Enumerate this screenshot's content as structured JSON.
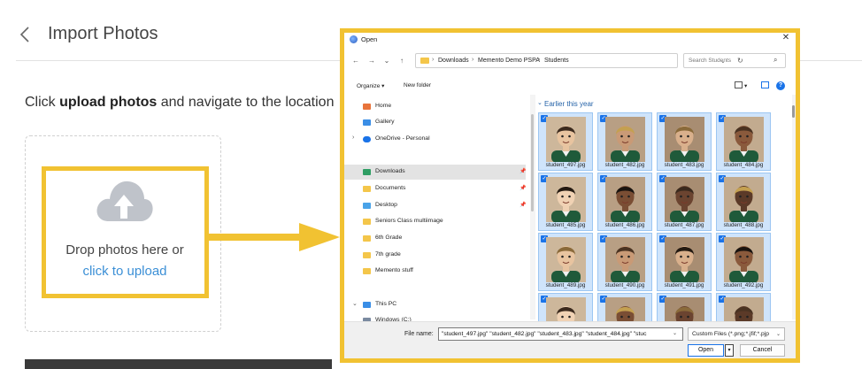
{
  "page": {
    "title": "Import Photos",
    "instructions": {
      "prefix": "Click ",
      "bold": "upload photos",
      "suffix": " and navigate to the location"
    },
    "dropzone": {
      "text": "Drop photos here or",
      "link": "click to upload"
    }
  },
  "dialog": {
    "title": "Open",
    "breadcrumb": [
      "Downloads",
      "Memento Demo PSPA",
      "Students"
    ],
    "search_placeholder": "Search Students",
    "commands": {
      "organize": "Organize ▾",
      "new_folder": "New folder"
    },
    "nav": {
      "home": "Home",
      "gallery": "Gallery",
      "onedrive": "OneDrive - Personal",
      "downloads": "Downloads",
      "documents": "Documents",
      "desktop": "Desktop",
      "seniors": "Seniors Class multiimage",
      "sixth": "6th Grade",
      "seventh": "7th grade",
      "memento": "Memento stuff",
      "thispc": "This PC",
      "windows": "Windows (C:)"
    },
    "group_title": "Earlier this year",
    "files": [
      "student_497.jpg",
      "student_482.jpg",
      "student_483.jpg",
      "student_484.jpg",
      "student_485.jpg",
      "student_486.jpg",
      "student_487.jpg",
      "student_488.jpg",
      "student_489.jpg",
      "student_490.jpg",
      "student_491.jpg",
      "student_492.jpg",
      "",
      "",
      "",
      ""
    ],
    "file_name_label": "File name:",
    "file_name_value": "\"student_497.jpg\" \"student_482.jpg\" \"student_483.jpg\" \"student_484.jpg\" \"stuc",
    "filter": "Custom Files (*.png;*.jfif;*.pjp",
    "open_label": "Open",
    "cancel_label": "Cancel"
  },
  "colors": {
    "highlight": "#f1c232",
    "link": "#3b8fd6",
    "selection": "#cfe4fb",
    "accent": "#1a73e8"
  }
}
